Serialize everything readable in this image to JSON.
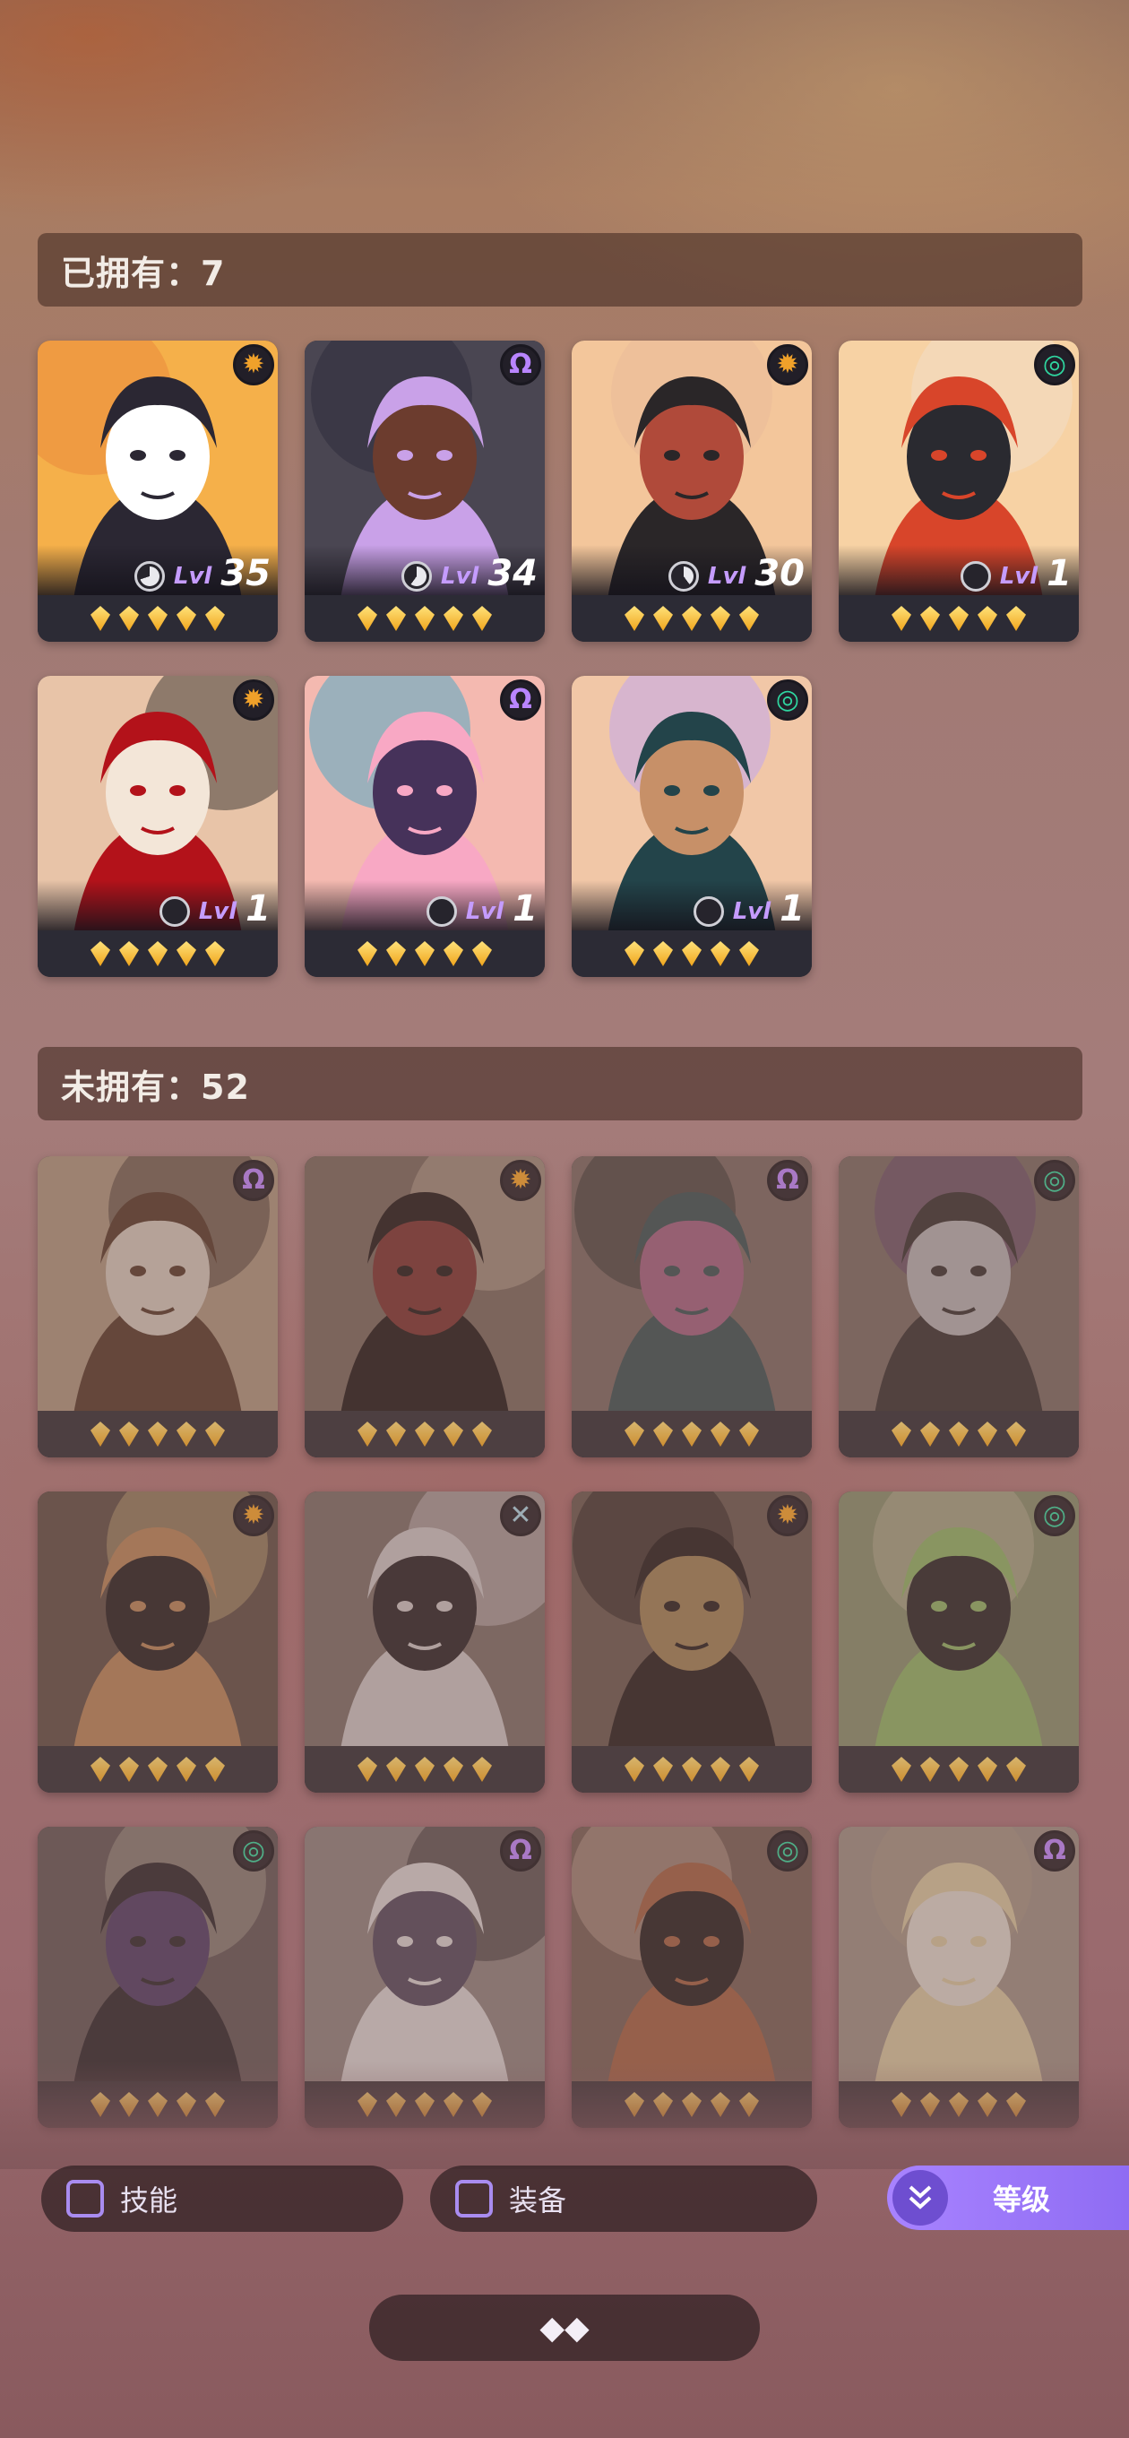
{
  "owned_section": {
    "title": "已拥有：7"
  },
  "unowned_section": {
    "title": "未拥有：52"
  },
  "owned_heroes": [
    {
      "faction": "sun",
      "level_label": "Lvl",
      "level": "35",
      "progress_pct": 70,
      "stars": 5
    },
    {
      "faction": "omega",
      "level_label": "Lvl",
      "level": "34",
      "progress_pct": 60,
      "stars": 5
    },
    {
      "faction": "sun",
      "level_label": "Lvl",
      "level": "30",
      "progress_pct": 40,
      "stars": 5
    },
    {
      "faction": "spiral",
      "level_label": "Lvl",
      "level": "1",
      "progress_pct": 0,
      "stars": 5
    },
    {
      "faction": "sun",
      "level_label": "Lvl",
      "level": "1",
      "progress_pct": 0,
      "stars": 5
    },
    {
      "faction": "omega",
      "level_label": "Lvl",
      "level": "1",
      "progress_pct": 0,
      "stars": 5
    },
    {
      "faction": "spiral",
      "level_label": "Lvl",
      "level": "1",
      "progress_pct": 0,
      "stars": 5
    }
  ],
  "unowned_heroes": [
    {
      "faction": "omega",
      "stars": 5
    },
    {
      "faction": "sun",
      "stars": 5
    },
    {
      "faction": "omega",
      "stars": 5
    },
    {
      "faction": "spiral",
      "stars": 5
    },
    {
      "faction": "sun",
      "stars": 5
    },
    {
      "faction": "cross",
      "stars": 5
    },
    {
      "faction": "sun",
      "stars": 5
    },
    {
      "faction": "spiral",
      "stars": 5
    },
    {
      "faction": "spiral",
      "stars": 5
    },
    {
      "faction": "omega",
      "stars": 5
    },
    {
      "faction": "spiral",
      "stars": 5
    },
    {
      "faction": "omega",
      "stars": 5
    }
  ],
  "faction_icons": {
    "sun": "sun-icon",
    "omega": "omega-icon",
    "spiral": "spiral-icon",
    "cross": "cross-icon"
  },
  "colors": {
    "faction_sun": "#f0a12a",
    "faction_omega": "#b985ff",
    "faction_spiral": "#2fd6a0",
    "faction_cross": "#a6d4e6",
    "level_label": "#c59cff",
    "sort_button": "#9b77fa"
  },
  "filters": {
    "skills_label": "技能",
    "skills_checked": false,
    "equipment_label": "装备",
    "equipment_checked": false
  },
  "sort": {
    "label": "等级",
    "icon": "double-chevron-down-icon"
  },
  "collapse": {
    "icon": "collapse-diamonds-icon",
    "glyph": "◆◆"
  }
}
